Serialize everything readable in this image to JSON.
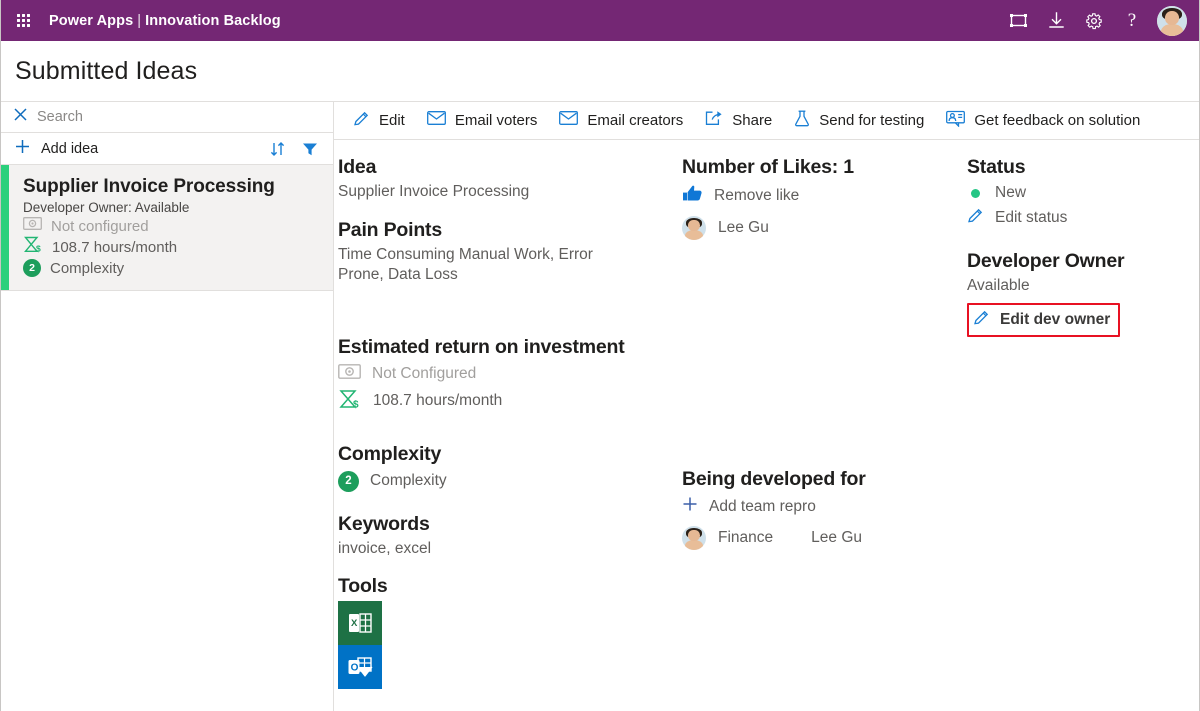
{
  "topbar": {
    "waffle_label": "App launcher",
    "brand_product": "Power Apps",
    "brand_separator": "|",
    "brand_app": "Innovation Backlog",
    "icons": [
      "fullscreen-icon",
      "download-icon",
      "gear-icon",
      "help-icon"
    ],
    "help_glyph": "?",
    "avatar_label": "Lee Gu"
  },
  "page": {
    "title": "Submitted Ideas"
  },
  "sidebar": {
    "search": {
      "placeholder": "Search",
      "value": "",
      "clear_icon": "close-icon"
    },
    "add": {
      "label": "Add idea",
      "plus_icon": "plus-icon",
      "sort_icon": "sort-icon",
      "filter_icon": "filter-icon"
    },
    "cards": [
      {
        "title": "Supplier Invoice Processing",
        "subtitle": "Developer Owner: Available",
        "roi_money": "Not configured",
        "roi_hours": "108.7 hours/month",
        "complexity_value": "2",
        "complexity_label": "Complexity",
        "accent_color": "#2bd07c",
        "selected": true
      }
    ]
  },
  "commandbar": {
    "items": [
      {
        "label": "Edit",
        "icon": "pencil-icon"
      },
      {
        "label": "Email voters",
        "icon": "envelope-icon"
      },
      {
        "label": "Email creators",
        "icon": "envelope-icon"
      },
      {
        "label": "Share",
        "icon": "share-icon"
      },
      {
        "label": "Send for testing",
        "icon": "flask-icon"
      },
      {
        "label": "Get feedback on solution",
        "icon": "person-feedback-icon"
      }
    ]
  },
  "detail": {
    "idea": {
      "heading": "Idea",
      "value": "Supplier Invoice Processing"
    },
    "pain_points": {
      "heading": "Pain Points",
      "value": "Time Consuming Manual Work, Error Prone, Data Loss"
    },
    "roi": {
      "heading": "Estimated return on investment",
      "money_value": "Not Configured",
      "money_icon": "money-icon",
      "hours_value": "108.7 hours/month",
      "hours_icon": "hourglass-money-icon"
    },
    "complexity": {
      "heading": "Complexity",
      "value": "2",
      "label": "Complexity"
    },
    "keywords": {
      "heading": "Keywords",
      "value": "invoice, excel"
    },
    "tools": {
      "heading": "Tools",
      "items": [
        {
          "name": "excel-icon",
          "letter": "X",
          "color": "#1e7145"
        },
        {
          "name": "outlook-icon",
          "letter": "O",
          "color": "#0072c6"
        }
      ]
    }
  },
  "likes": {
    "heading": "Number of Likes: 1",
    "action_label": "Remove like",
    "action_icon": "thumbs-up-icon",
    "voters": [
      {
        "name": "Lee Gu"
      }
    ]
  },
  "developed_for": {
    "heading": "Being developed for",
    "add_label": "Add team repro",
    "add_icon": "plus-icon",
    "teams": [
      {
        "team": "Finance",
        "owner": "Lee Gu"
      }
    ]
  },
  "status": {
    "heading": "Status",
    "value": "New",
    "dot_color": "#25c685",
    "edit_label": "Edit status",
    "edit_icon": "pencil-icon"
  },
  "developer_owner": {
    "heading": "Developer Owner",
    "value": "Available",
    "edit_label": "Edit dev owner",
    "edit_icon": "pencil-icon",
    "highlight_color": "#e81123"
  }
}
